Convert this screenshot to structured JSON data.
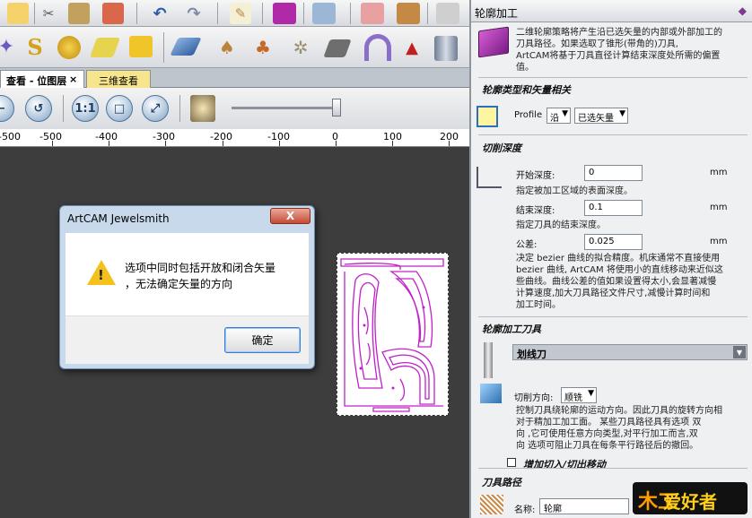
{
  "tabs": {
    "view2d": "查看 - 位图层",
    "view2d_close": "×",
    "view3d": "三维查看"
  },
  "ruler": {
    "labels": [
      "-500",
      "-400",
      "-300",
      "-200",
      "-100",
      "0",
      "100",
      "200"
    ]
  },
  "dialog": {
    "title": "ArtCAM Jewelsmith",
    "close": "X",
    "message_line1": "选项中同时包括开放和闭合矢量",
    "message_line2": "，无法确定矢量的方向",
    "ok": "确定"
  },
  "panel": {
    "title": "轮廓加工",
    "intro_1": "二维轮廓策略将产生沿已选矢量的内部或外部加工的",
    "intro_2": "刀具路径。如果选取了锥形(带角的)刀具,",
    "intro_3": "ArtCAM将基于刀具直径计算结束深度处所需的偏置",
    "intro_4": "值。",
    "section_profile": "轮廓类型和矢量相关",
    "profile_label": "Profile",
    "profile_side": "沿",
    "profile_vectors": "已选矢量",
    "section_depth": "切削深度",
    "start_depth_label": "开始深度:",
    "start_depth_value": "0",
    "start_depth_unit": "mm",
    "start_depth_hint": "指定被加工区域的表面深度。",
    "end_depth_label": "结束深度:",
    "end_depth_value": "0.1",
    "end_depth_unit": "mm",
    "end_depth_hint": "指定刀具的结束深度。",
    "tolerance_label": "公差:",
    "tolerance_value": "0.025",
    "tolerance_unit": "mm",
    "tol_hint_1": "决定 bezier 曲线的拟合精度。机床通常不直接使用",
    "tol_hint_2": "bezier 曲线, ArtCAM 将使用小的直线移动来近似这",
    "tol_hint_3": "些曲线。曲线公差的值如果设置得太小,会显著减慢",
    "tol_hint_4": "计算速度,加大刀具路径文件尺寸,减慢计算时间和",
    "tol_hint_5": "加工时间。",
    "section_tool": "轮廓加工刀具",
    "tool_name": "划线刀",
    "tool_dd": "▼",
    "cut_dir_label": "切削方向:",
    "cut_dir_value": "顺铣",
    "cut_hint_1": "控制刀具绕轮廓的运动方向。因此刀具的旋转方向相",
    "cut_hint_2": "对于精加工加工面。 某些刀具路径具有选项 双",
    "cut_hint_3": "向 ,它可使用任意方向类型,对平行加工而言,双",
    "cut_hint_4": "向 选项可阻止刀具在每条平行路径后的撤回。",
    "section_leadin": "增加切入/切出移动",
    "section_toolpath": "刀具路径",
    "name_label": "名称:",
    "name_value": "轮廓",
    "pin": "◆"
  },
  "logo": {
    "mark": "木工",
    "text": "爱好者"
  },
  "icons": [
    "cut-icon",
    "copy-icon",
    "paste-icon",
    "undo-icon",
    "redo-icon",
    "notepad-icon",
    "book-icon",
    "paint-icon",
    "figure-icon",
    "bear-icon",
    "robot-icon"
  ]
}
